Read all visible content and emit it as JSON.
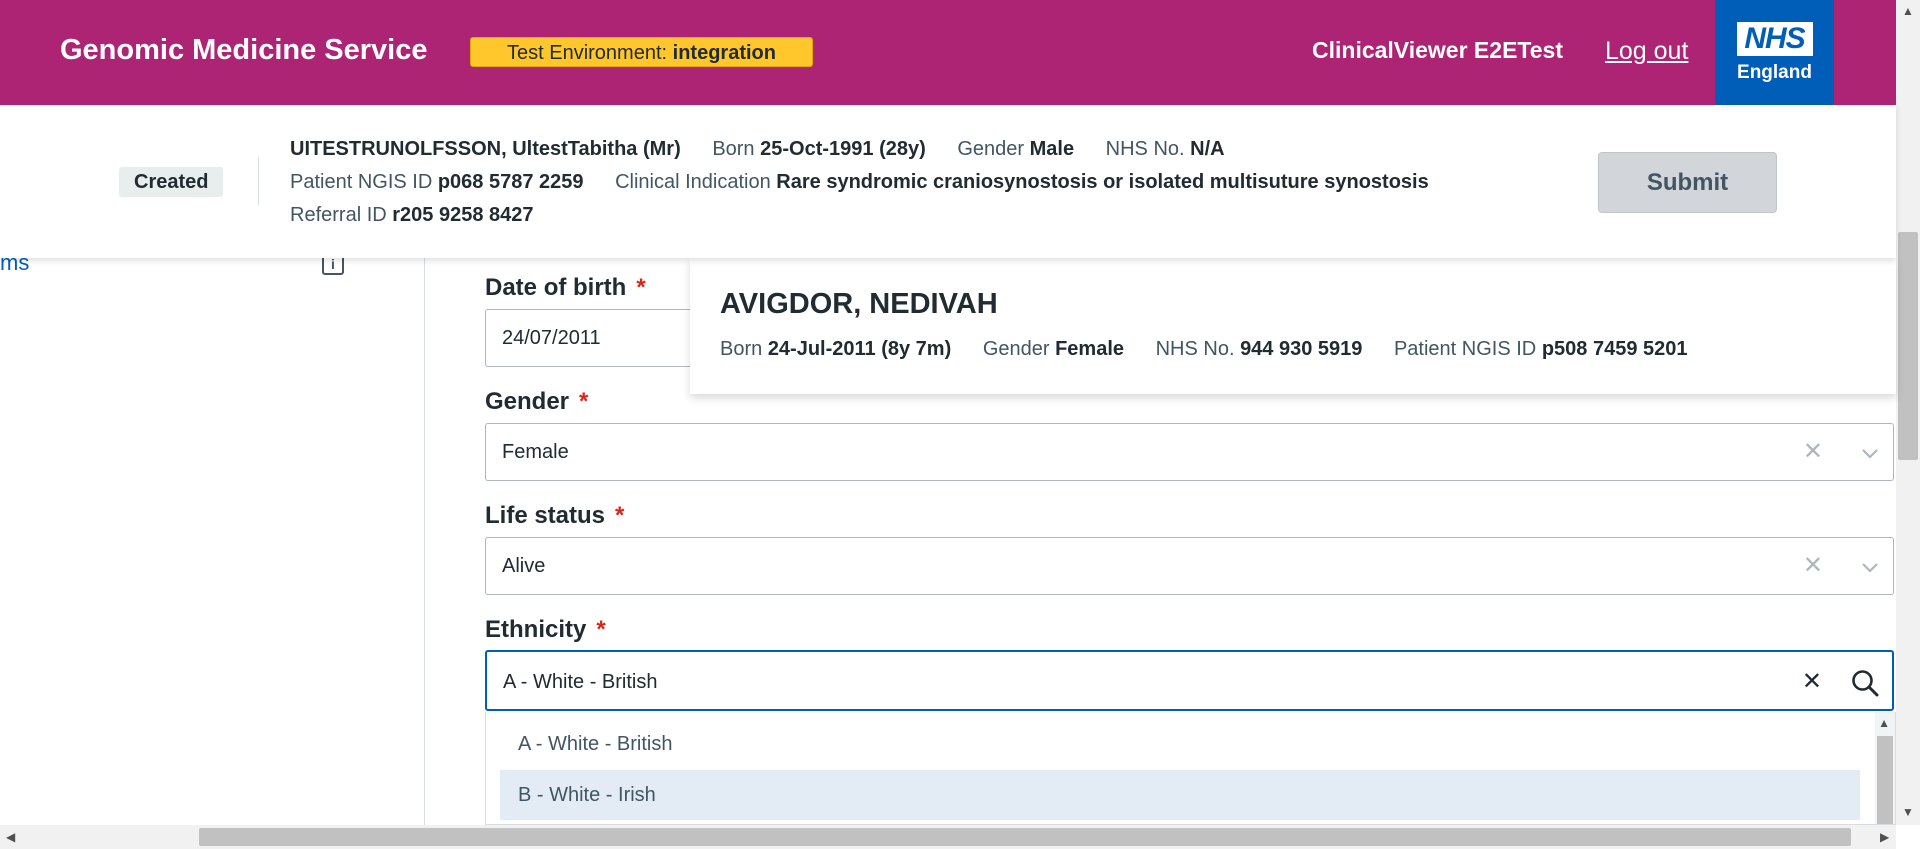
{
  "header": {
    "brand": "Genomic Medicine Service",
    "env_label": "Test Environment:",
    "env_value": "integration",
    "username": "ClinicalViewer E2ETest",
    "logout": "Log out",
    "logo_main": "NHS",
    "logo_sub": "England"
  },
  "referral": {
    "status": "Created",
    "patient_name": "UITESTRUNOLFSSON, UltestTabitha (Mr)",
    "born_label": "Born",
    "born_value": "25-Oct-1991 (28y)",
    "gender_label": "Gender",
    "gender_value": "Male",
    "nhs_label": "NHS No.",
    "nhs_value": "N/A",
    "ngis_label": "Patient NGIS ID",
    "ngis_value": "p068 5787 2259",
    "ci_label": "Clinical Indication",
    "ci_value": "Rare syndromic craniosynostosis or isolated multisuture synostosis",
    "referral_label": "Referral ID",
    "referral_value": "r205 9258 8427",
    "submit": "Submit"
  },
  "sidebar": {
    "link_fragment": "ms"
  },
  "form": {
    "dob_label": "Date of birth",
    "dob_value": "24/07/2011",
    "gender_label": "Gender",
    "gender_value": "Female",
    "life_label": "Life status",
    "life_value": "Alive",
    "ethnicity_label": "Ethnicity",
    "ethnicity_value": "A - White - British",
    "required_mark": "*",
    "clear": "✕"
  },
  "popover": {
    "name": "AVIGDOR, NEDIVAH",
    "born_label": "Born",
    "born_value": "24-Jul-2011 (8y 7m)",
    "gender_label": "Gender",
    "gender_value": "Female",
    "nhs_label": "NHS No.",
    "nhs_value": "944 930 5919",
    "ngis_label": "Patient NGIS ID",
    "ngis_value": "p508 7459 5201"
  },
  "dropdown": {
    "options": [
      "A - White - British",
      "B - White - Irish"
    ],
    "highlighted_index": 1
  },
  "colors": {
    "header_bg": "#ad2474",
    "env_badge": "#ffc72c",
    "nhs_blue": "#005eb8",
    "required": "#d5281b",
    "highlight": "#e3ecf5"
  }
}
